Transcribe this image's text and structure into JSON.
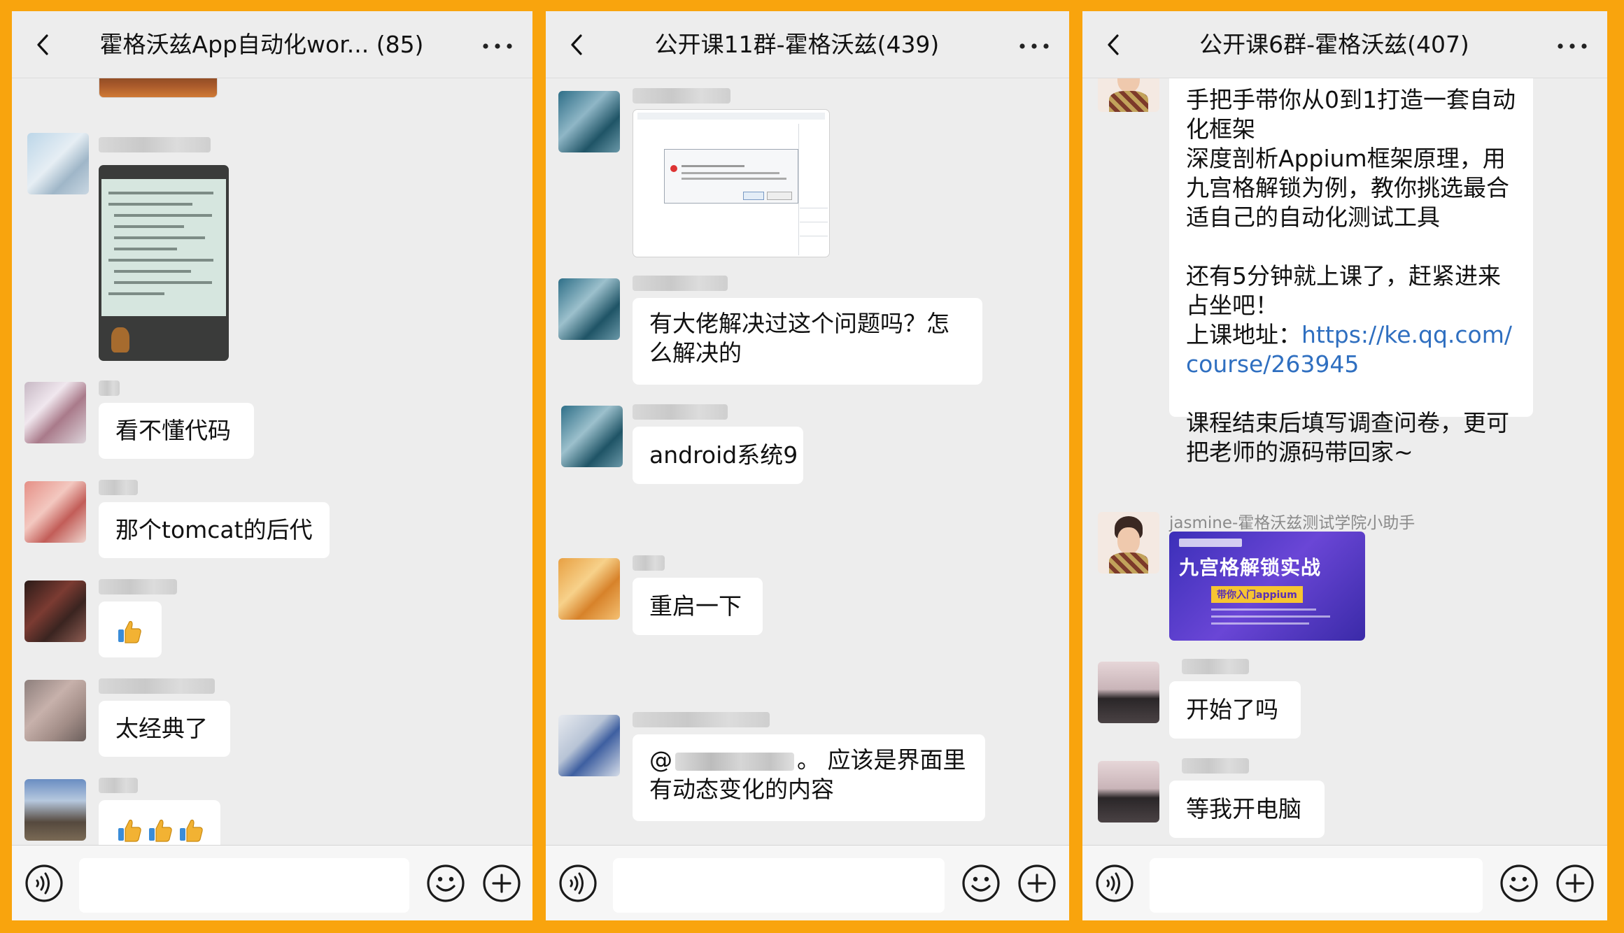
{
  "panels": [
    {
      "title": "霍格沃兹App自动化wor... (85)",
      "messages": {
        "m1": "看不懂代码",
        "m2": "那个tomcat的后代",
        "m3": "太经典了"
      }
    },
    {
      "title": "公开课11群-霍格沃兹(439)",
      "messages": {
        "m1": "有大佬解决过这个问题吗？怎么解决的",
        "m2": "android系统9",
        "m3": "重启一下",
        "m4_prefix": "@",
        "m4_rest": "。 应该是界面里有动态变化的内容"
      }
    },
    {
      "title": "公开课6群-霍格沃兹(407)",
      "announcement": {
        "line1": "手把手带你从0到1打造一套自动化框架",
        "line2": "深度剖析Appium框架原理，用九宫格解锁为例，教你挑选最合适自己的自动化测试工具",
        "line3": "还有5分钟就上课了，赶紧进来占坐吧！",
        "link_label": "上课地址：",
        "link_url": "https://ke.qq.com/course/263945",
        "line4": "课程结束后填写调查问卷，更可把老师的源码带回家~"
      },
      "assistant_name": "jasmine-霍格沃兹测试学院小助手",
      "banner": {
        "title": "九宫格解锁实战",
        "subtitle": "带你入门appium"
      },
      "messages": {
        "m1": "开始了吗",
        "m2": "等我开电脑"
      }
    }
  ],
  "colors": {
    "frame": "#F9A40D",
    "chat_background": "#EDEDED",
    "bubble": "#FFFFFF",
    "link": "#2F6FC0",
    "banner": "#5B3FD0"
  },
  "icons": [
    "back-icon",
    "more-icon",
    "voice-icon",
    "emoji-icon",
    "plus-icon",
    "thumbs-up-icon"
  ]
}
